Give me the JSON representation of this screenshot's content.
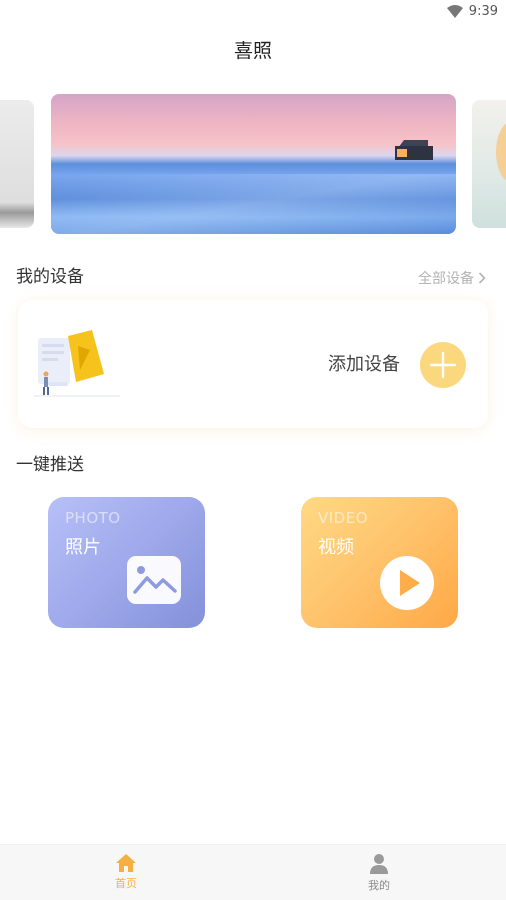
{
  "status_bar": {
    "time": "9:39",
    "wifi_icon": "wifi-icon"
  },
  "app": {
    "title": "喜照"
  },
  "banner": {
    "slides": 3,
    "active_index": 1
  },
  "devices": {
    "section_title": "我的设备",
    "all_label": "全部设备",
    "add_label": "添加设备",
    "accent": "#fbd87d"
  },
  "push": {
    "section_title": "一键推送",
    "photo": {
      "en": "PHOTO",
      "zh": "照片",
      "icon": "image-icon"
    },
    "video": {
      "en": "VIDEO",
      "zh": "视频",
      "icon": "play-icon"
    }
  },
  "tabs": [
    {
      "label": "首页",
      "icon": "home-icon",
      "active": true
    },
    {
      "label": "我的",
      "icon": "user-icon",
      "active": false
    }
  ],
  "colors": {
    "tab_active": "#f5b042",
    "tab_inactive": "#8a8a8a"
  }
}
